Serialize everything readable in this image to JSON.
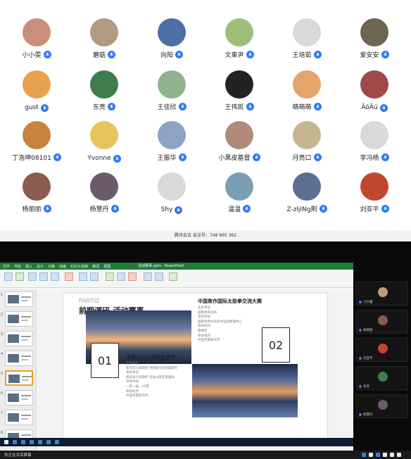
{
  "participants": [
    {
      "name": "小小雯",
      "avatar": "#c98f7a"
    },
    {
      "name": "蘑菇",
      "avatar": "#b09a82"
    },
    {
      "name": "向阳",
      "avatar": "#4e6fa6"
    },
    {
      "name": "文車尹",
      "avatar": "#9cc07a"
    },
    {
      "name": "王培茹",
      "avatar": "#d9d9d9"
    },
    {
      "name": "爱安安",
      "avatar": "#6f6452"
    },
    {
      "name": "gust",
      "avatar": "#e7a24e"
    },
    {
      "name": "东亮",
      "avatar": "#3f7d4c"
    },
    {
      "name": "王佳欣",
      "avatar": "#8fb48d"
    },
    {
      "name": "王伟凯",
      "avatar": "#222222"
    },
    {
      "name": "萌萌萌",
      "avatar": "#e3a56a"
    },
    {
      "name": "ÃöÃú",
      "avatar": "#9e4a4a"
    },
    {
      "name": "丁浩坤08101",
      "avatar": "#c8843e"
    },
    {
      "name": "Yvonne",
      "avatar": "#e8c45c"
    },
    {
      "name": "王振华",
      "avatar": "#8da2c4"
    },
    {
      "name": "小黑皮基督",
      "avatar": "#b08a7a"
    },
    {
      "name": "月亮口",
      "avatar": "#c6b68f"
    },
    {
      "name": "李冯杨",
      "avatar": "#d9d9d9"
    },
    {
      "name": "杨丽丽",
      "avatar": "#8b5b4f"
    },
    {
      "name": "杨慧丹",
      "avatar": "#6a5a6c"
    },
    {
      "name": "Shy",
      "avatar": "#d9d9d9"
    },
    {
      "name": "温温",
      "avatar": "#7a9fb5"
    },
    {
      "name": "Z-zljINg荆",
      "avatar": "#5b6f93"
    },
    {
      "name": "刘亚平",
      "avatar": "#c2472f"
    }
  ],
  "meeting_bar_text": "腾讯会议 会议号：748 865 362",
  "ppt": {
    "ribbon_tabs": [
      "文件",
      "开始",
      "插入",
      "设计",
      "切换",
      "动画",
      "幻灯片放映",
      "审阅",
      "视图"
    ],
    "window_title": "活动赛事.pptx - PowerPoint",
    "slide_count": 8,
    "selected_slide": 5
  },
  "slide": {
    "part": "PART02",
    "title": "前期调研-活动赛事",
    "box1_num": "01",
    "box2_num": "02",
    "event1_title": "中国云台山国际旅游节",
    "event1_lines": [
      "主办单位",
      "焦作市人民政府 河南省文化和旅游厅",
      "承办单位",
      "修武县人民政府 云台山景区管理局",
      "举办时间",
      "一年一届，10月",
      "举办地点",
      "中国河南焦作市"
    ],
    "event2_title": "中国焦作国际太极拳交流大赛",
    "event2_lines": [
      "主办单位",
      "国家体育总局",
      "承办单位",
      "国家体育总局武术运动管理中心",
      "举办时间",
      "每两年",
      "举办地点",
      "中国河南焦作市"
    ]
  },
  "side_panel": [
    {
      "name": "小文蕾",
      "avatar": "#b99a7a"
    },
    {
      "name": "杨丽丽",
      "avatar": "#8b5b4f"
    },
    {
      "name": "刘亚平",
      "avatar": "#c2472f"
    },
    {
      "name": "东亮",
      "avatar": "#3f7d4c"
    },
    {
      "name": "杨慧丹",
      "avatar": "#6a5a6c"
    }
  ],
  "bottom_bar": {
    "share_label": "你正在共享屏幕"
  }
}
